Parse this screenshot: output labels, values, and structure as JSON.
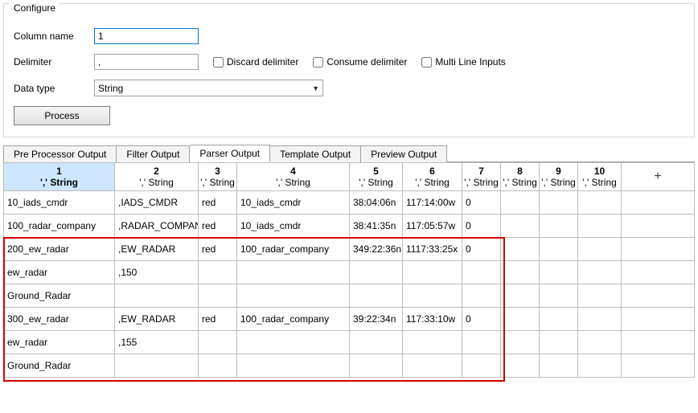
{
  "configure": {
    "legend": "Configure",
    "column_name_label": "Column name",
    "column_name_value": "1",
    "delimiter_label": "Delimiter",
    "delimiter_value": ",",
    "discard_label": "Discard delimiter",
    "consume_label": "Consume delimiter",
    "multiline_label": "Multi Line Inputs",
    "data_type_label": "Data type",
    "data_type_value": "String",
    "process_label": "Process"
  },
  "tabs": [
    "Pre Processor Output",
    "Filter Output",
    "Parser Output",
    "Template Output",
    "Preview Output"
  ],
  "active_tab_index": 2,
  "columns": [
    {
      "num": "1",
      "sub": "',' String"
    },
    {
      "num": "2",
      "sub": "',' String"
    },
    {
      "num": "3",
      "sub": "',' String"
    },
    {
      "num": "4",
      "sub": "',' String"
    },
    {
      "num": "5",
      "sub": "',' String"
    },
    {
      "num": "6",
      "sub": "',' String"
    },
    {
      "num": "7",
      "sub": "',' String"
    },
    {
      "num": "8",
      "sub": "',' String"
    },
    {
      "num": "9",
      "sub": "',' String"
    },
    {
      "num": "10",
      "sub": "',' String"
    }
  ],
  "add_col_label": "+",
  "rows": [
    [
      "10_iads_cmdr",
      ",IADS_CMDR",
      "red",
      "10_iads_cmdr",
      "38:04:06n",
      "117:14:00w",
      "0",
      "",
      "",
      ""
    ],
    [
      "100_radar_company",
      ",RADAR_COMPANY",
      "red",
      "10_iads_cmdr",
      "38:41:35n",
      "117:05:57w",
      "0",
      "",
      "",
      ""
    ],
    [
      "200_ew_radar",
      ",EW_RADAR",
      "red",
      "100_radar_company",
      "349:22:36n",
      "1117:33:25x",
      "0",
      "",
      "",
      ""
    ],
    [
      "ew_radar",
      ",150",
      "",
      "",
      "",
      "",
      "",
      "",
      "",
      ""
    ],
    [
      "Ground_Radar",
      "",
      "",
      "",
      "",
      "",
      "",
      "",
      "",
      ""
    ],
    [
      "300_ew_radar",
      ",EW_RADAR",
      "red",
      "100_radar_company",
      "39:22:34n",
      "117:33:10w",
      "0",
      "",
      "",
      ""
    ],
    [
      "ew_radar",
      ",155",
      "",
      "",
      "",
      "",
      "",
      "",
      "",
      ""
    ],
    [
      "Ground_Radar",
      "",
      "",
      "",
      "",
      "",
      "",
      "",
      "",
      ""
    ]
  ],
  "highlight": {
    "row_start": 2,
    "row_end": 7
  }
}
